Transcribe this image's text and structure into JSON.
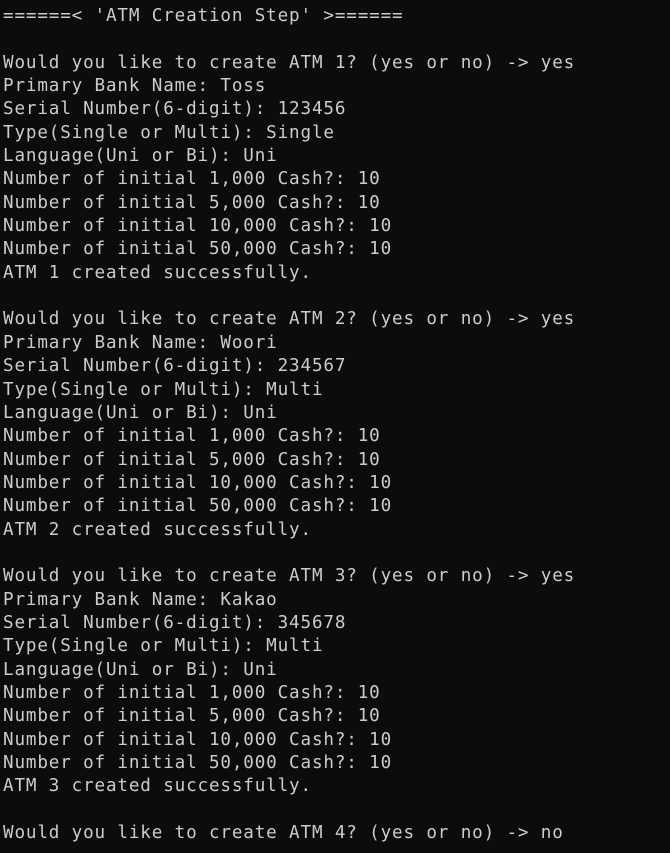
{
  "terminal": {
    "lines": [
      "======< 'ATM Creation Step' >======",
      "",
      "Would you like to create ATM 1? (yes or no) -> yes",
      "Primary Bank Name: Toss",
      "Serial Number(6-digit): 123456",
      "Type(Single or Multi): Single",
      "Language(Uni or Bi): Uni",
      "Number of initial 1,000 Cash?: 10",
      "Number of initial 5,000 Cash?: 10",
      "Number of initial 10,000 Cash?: 10",
      "Number of initial 50,000 Cash?: 10",
      "ATM 1 created successfully.",
      "",
      "Would you like to create ATM 2? (yes or no) -> yes",
      "Primary Bank Name: Woori",
      "Serial Number(6-digit): 234567",
      "Type(Single or Multi): Multi",
      "Language(Uni or Bi): Uni",
      "Number of initial 1,000 Cash?: 10",
      "Number of initial 5,000 Cash?: 10",
      "Number of initial 10,000 Cash?: 10",
      "Number of initial 50,000 Cash?: 10",
      "ATM 2 created successfully.",
      "",
      "Would you like to create ATM 3? (yes or no) -> yes",
      "Primary Bank Name: Kakao",
      "Serial Number(6-digit): 345678",
      "Type(Single or Multi): Multi",
      "Language(Uni or Bi): Uni",
      "Number of initial 1,000 Cash?: 10",
      "Number of initial 5,000 Cash?: 10",
      "Number of initial 10,000 Cash?: 10",
      "Number of initial 50,000 Cash?: 10",
      "ATM 3 created successfully.",
      "",
      "Would you like to create ATM 4? (yes or no) -> no"
    ]
  }
}
